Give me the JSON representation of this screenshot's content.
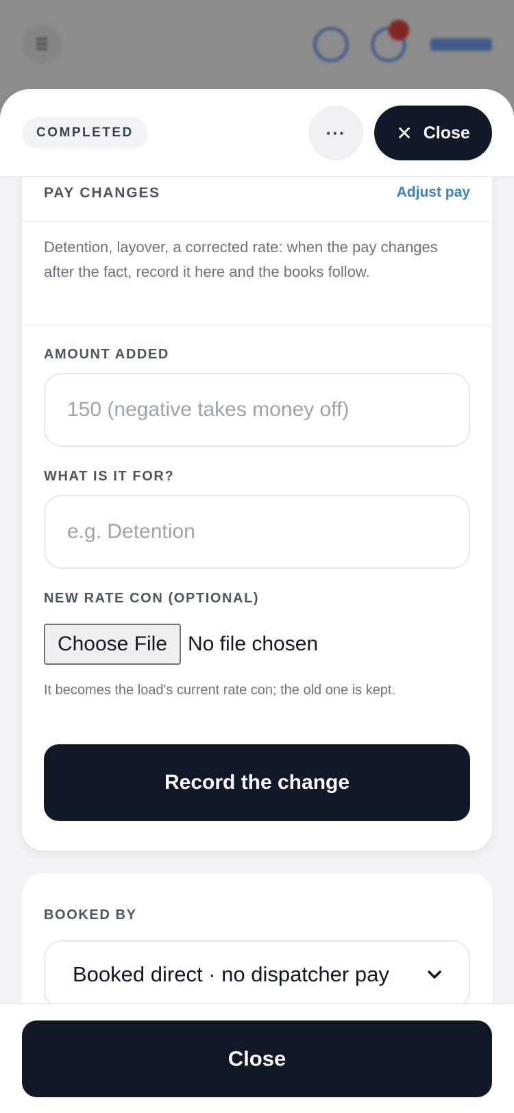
{
  "background_header": {
    "menu_icon": "hamburger-icon",
    "title": "",
    "subtitle": ""
  },
  "sheet": {
    "status": "COMPLETED",
    "more_icon": "ellipsis-icon",
    "more_label": "···",
    "close_icon": "close-icon",
    "close_icon_glyph": "✕",
    "close_label": "Close"
  },
  "pay_changes": {
    "label": "PAY CHANGES",
    "adjust_link": "Adjust pay",
    "description": "Detention, layover, a corrected rate: when the pay changes after the fact, record it here and the books follow.",
    "amount": {
      "label": "AMOUNT ADDED",
      "value": "",
      "placeholder": "150 (negative takes money off)"
    },
    "purpose": {
      "label": "WHAT IS IT FOR?",
      "value": "",
      "placeholder": "e.g. Detention"
    },
    "rate_con": {
      "label": "NEW RATE CON (OPTIONAL)",
      "button": "Choose File",
      "status": "No file chosen",
      "hint": "It becomes the load's current rate con; the old one is kept."
    },
    "submit_label": "Record the change"
  },
  "booked_by": {
    "label": "BOOKED BY",
    "selected": "Booked direct · no dispatcher pay",
    "chevron_icon": "chevron-down-icon",
    "chevron_glyph": "⌄"
  },
  "footer": {
    "close_label": "Close"
  },
  "colors": {
    "primary": "#111827",
    "link": "#3b82c4",
    "badge": "#ef4444",
    "background": "#f1f3f6"
  }
}
